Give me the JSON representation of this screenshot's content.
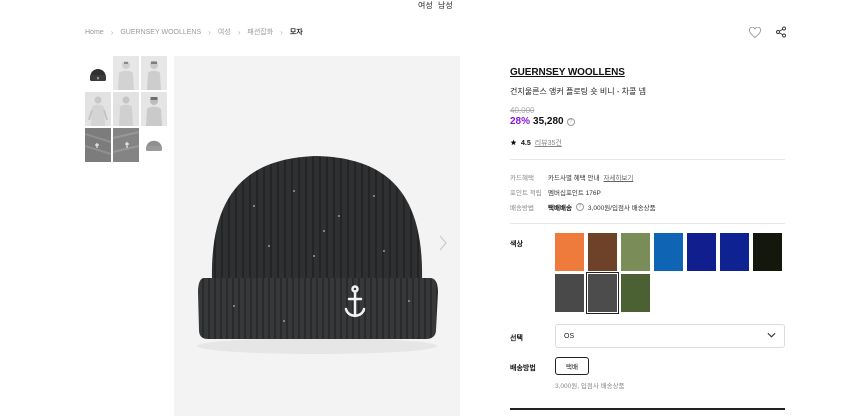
{
  "top_nav": {
    "women": "여성",
    "men": "남성"
  },
  "breadcrumb": [
    "Home",
    "GUERNSEY WOOLLENS",
    "여성",
    "패션잡화",
    "모자"
  ],
  "icons": {
    "wishlist": "heart-icon",
    "share": "share-icon"
  },
  "product": {
    "brand": "GUERNSEY WOOLLENS",
    "name": "건지울른스 앵커 플로팅 숏 비니 - 차콜 넵",
    "original_price": "40,000",
    "discount": "28%",
    "sale_price": "35,280",
    "rating": "4.5",
    "review_text": "리뷰35건"
  },
  "benefits": {
    "card": {
      "label": "카드혜택",
      "value": "카드사별 혜택 안내",
      "link": "자세히보기"
    },
    "points": {
      "label": "포인트 적립",
      "value": "멤버십포인트 176P"
    },
    "shipping": {
      "label": "배송방법",
      "tag": "택배배송",
      "value": "3,000원/입점사 배송상품"
    }
  },
  "options": {
    "color_label": "색상",
    "colors": [
      "#ee7b3b",
      "#6e4129",
      "#7a8d59",
      "#1064b4",
      "#111f8e",
      "#0f2292",
      "#14170c",
      "#494949",
      "#4c4c4c",
      "#4b6134"
    ],
    "selected_color_index": 8,
    "select_label": "선택",
    "select_value": "OS",
    "shipping_label": "배송방법",
    "shipping_option": "택배",
    "shipping_note": "3,000원, 입점사 배송상품"
  },
  "colors": {
    "accent": "#8b16d8",
    "beanie": "#2f3032",
    "background": "#f3f3f3"
  }
}
